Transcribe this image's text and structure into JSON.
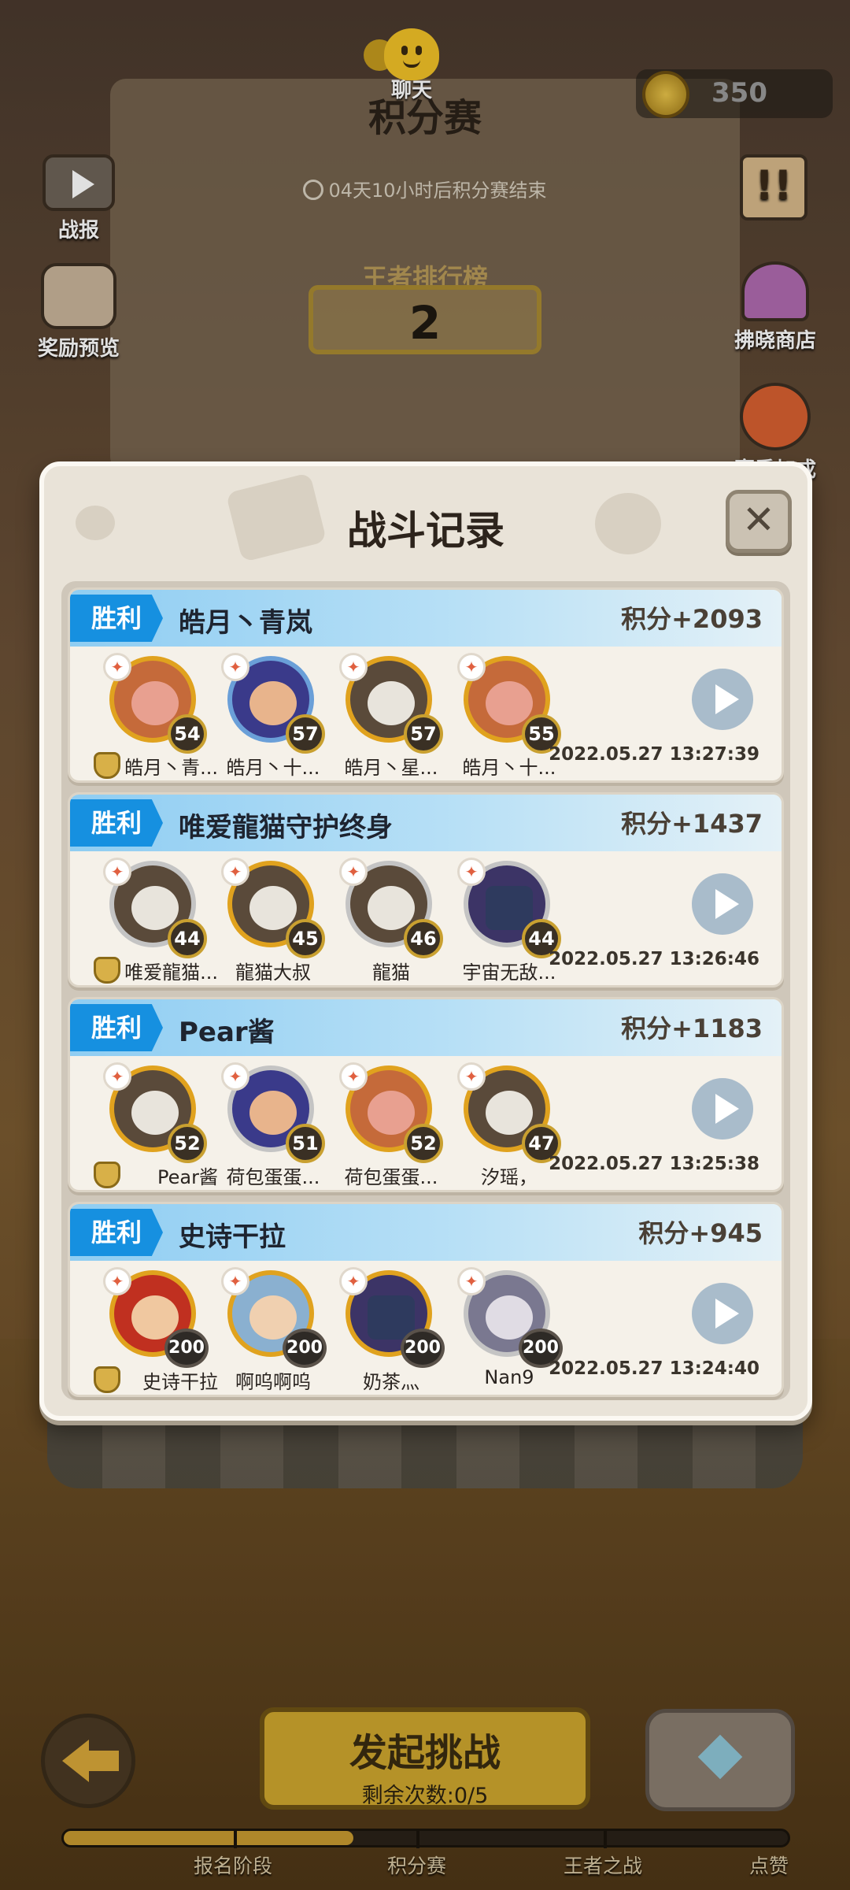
{
  "header": {
    "chat_label": "聊天",
    "coins": "350",
    "title": "积分赛",
    "timer": "04天10小时后积分赛结束",
    "rank_label": "王者排行榜",
    "rank_value": "2"
  },
  "side_left": [
    {
      "label": "战报",
      "icon": "tv-replay-icon"
    },
    {
      "label": "奖励预览",
      "icon": "treasure-chest-icon"
    }
  ],
  "side_right": [
    {
      "label": "",
      "icon": "notice-scroll-icon"
    },
    {
      "label": "拂晓商店",
      "icon": "shop-icon"
    },
    {
      "label": "赛季加成",
      "icon": "bonus-icon"
    }
  ],
  "modal": {
    "title": "战斗记录",
    "close_icon": "close-icon",
    "records": [
      {
        "result": "胜利",
        "opponent": "皓月丶青岚",
        "score": "积分+2093",
        "time": "2022.05.27 13:27:39",
        "pets": [
          {
            "name": "皓月丶青...",
            "level": "54",
            "style": "boar",
            "ring": "gold"
          },
          {
            "name": "皓月丶十...",
            "level": "57",
            "style": "human",
            "ring": "blue"
          },
          {
            "name": "皓月丶星...",
            "level": "57",
            "style": "tiger",
            "ring": "gold"
          },
          {
            "name": "皓月丶十...",
            "level": "55",
            "style": "boar",
            "ring": "gold"
          }
        ]
      },
      {
        "result": "胜利",
        "opponent": "唯爱龍猫守护终身",
        "score": "积分+1437",
        "time": "2022.05.27 13:26:46",
        "pets": [
          {
            "name": "唯爱龍猫...",
            "level": "44",
            "style": "tiger",
            "ring": "silver"
          },
          {
            "name": "龍猫大叔",
            "level": "45",
            "style": "tiger",
            "ring": "gold"
          },
          {
            "name": "龍猫",
            "level": "46",
            "style": "tiger",
            "ring": "silver"
          },
          {
            "name": "宇宙无敌...",
            "level": "44",
            "style": "robot",
            "ring": "silver"
          }
        ]
      },
      {
        "result": "胜利",
        "opponent": "Pear酱",
        "score": "积分+1183",
        "time": "2022.05.27 13:25:38",
        "pets": [
          {
            "name": "Pear酱",
            "level": "52",
            "style": "tiger",
            "ring": "gold"
          },
          {
            "name": "荷包蛋蛋...",
            "level": "51",
            "style": "human",
            "ring": "silver"
          },
          {
            "name": "荷包蛋蛋...",
            "level": "52",
            "style": "boar",
            "ring": "gold"
          },
          {
            "name": "汐瑶，",
            "level": "47",
            "style": "tiger",
            "ring": "gold"
          }
        ]
      },
      {
        "result": "胜利",
        "opponent": "史诗干拉",
        "score": "积分+945",
        "time": "2022.05.27 13:24:40",
        "pets": [
          {
            "name": "史诗干拉",
            "level": "200",
            "style": "red",
            "ring": "gold"
          },
          {
            "name": "啊呜啊呜",
            "level": "200",
            "style": "elf",
            "ring": "gold"
          },
          {
            "name": "奶茶灬",
            "level": "200",
            "style": "robot",
            "ring": "gold"
          },
          {
            "name": "Nan9",
            "level": "200",
            "style": "white",
            "ring": "silver"
          }
        ]
      }
    ]
  },
  "bottom": {
    "challenge_title": "发起挑战",
    "challenge_sub": "剩余次数:0/5",
    "progress_fraction": 0.4,
    "stages": [
      "报名阶段",
      "积分赛",
      "王者之战",
      "点赞"
    ]
  }
}
